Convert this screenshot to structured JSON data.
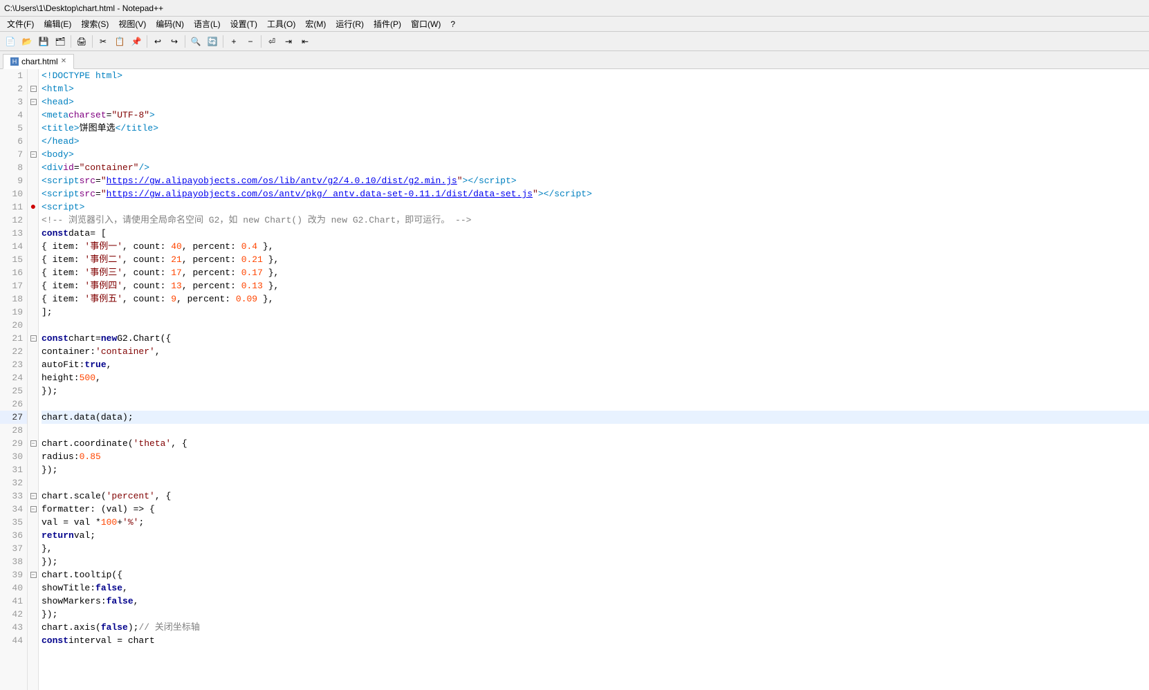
{
  "window": {
    "title": "C:\\Users\\1\\Desktop\\chart.html - Notepad++",
    "tab_label": "chart.html"
  },
  "menu": {
    "items": [
      "文件(F)",
      "编辑(E)",
      "搜索(S)",
      "视图(V)",
      "编码(N)",
      "语言(L)",
      "设置(T)",
      "工具(O)",
      "宏(M)",
      "运行(R)",
      "插件(P)",
      "窗口(W)",
      "?"
    ]
  },
  "code_lines": [
    {
      "num": 1,
      "fold": "",
      "content": "<!DOCTYPE html>"
    },
    {
      "num": 2,
      "fold": "□",
      "content": "    <html>"
    },
    {
      "num": 3,
      "fold": "□",
      "content": "        <head>"
    },
    {
      "num": 4,
      "fold": "",
      "content": "            <meta charset=\"UTF-8\">"
    },
    {
      "num": 5,
      "fold": "",
      "content": "            <title>饼图单选</title>"
    },
    {
      "num": 6,
      "fold": "",
      "content": "        </head>"
    },
    {
      "num": 7,
      "fold": "□",
      "content": "        <body>"
    },
    {
      "num": 8,
      "fold": "",
      "content": "            <div id=\"container\" />"
    },
    {
      "num": 9,
      "fold": "",
      "content": "            <script src=\"https://gw.alipayobjects.com/os/lib/antv/g2/4.0.10/dist/g2.min.js\"></script>"
    },
    {
      "num": 10,
      "fold": "",
      "content": "            <script src=\"https://gw.alipayobjects.com/os/antv/pkg/_antv.data-set-0.11.1/dist/data-set.js\"></script>"
    },
    {
      "num": 11,
      "fold": "□",
      "content": "            <script>"
    },
    {
      "num": 12,
      "fold": "",
      "content": "            <!-- 浏览器引入，请使用全局命名空间 G2，如 new Chart() 改为 new G2.Chart，即可运行。 -->"
    },
    {
      "num": 13,
      "fold": "",
      "content": "                const data = ["
    },
    {
      "num": 14,
      "fold": "",
      "content": "  { item: '事例一', count: 40, percent: 0.4 },"
    },
    {
      "num": 15,
      "fold": "",
      "content": "  { item: '事例二', count: 21, percent: 0.21 },"
    },
    {
      "num": 16,
      "fold": "",
      "content": "  { item: '事例三', count: 17, percent: 0.17 },"
    },
    {
      "num": 17,
      "fold": "",
      "content": "  { item: '事例四', count: 13, percent: 0.13 },"
    },
    {
      "num": 18,
      "fold": "",
      "content": "  { item: '事例五', count: 9, percent: 0.09 },"
    },
    {
      "num": 19,
      "fold": "",
      "content": "];"
    },
    {
      "num": 20,
      "fold": "",
      "content": ""
    },
    {
      "num": 21,
      "fold": "□",
      "content": "      const chart = new G2.Chart({"
    },
    {
      "num": 22,
      "fold": "",
      "content": "        container: 'container',"
    },
    {
      "num": 23,
      "fold": "",
      "content": "        autoFit: true,"
    },
    {
      "num": 24,
      "fold": "",
      "content": "        height: 500,"
    },
    {
      "num": 25,
      "fold": "",
      "content": "      });"
    },
    {
      "num": 26,
      "fold": "",
      "content": ""
    },
    {
      "num": 27,
      "fold": "",
      "content": "      chart.data(data);",
      "highlight": true
    },
    {
      "num": 28,
      "fold": "",
      "content": ""
    },
    {
      "num": 29,
      "fold": "□",
      "content": "      chart.coordinate('theta', {"
    },
    {
      "num": 30,
      "fold": "",
      "content": "        radius: 0.85"
    },
    {
      "num": 31,
      "fold": "",
      "content": "      });"
    },
    {
      "num": 32,
      "fold": "",
      "content": ""
    },
    {
      "num": 33,
      "fold": "□",
      "content": "      chart.scale('percent', {"
    },
    {
      "num": 34,
      "fold": "□",
      "content": "        formatter: (val) => {"
    },
    {
      "num": 35,
      "fold": "",
      "content": "          val = val * 100 + '%';"
    },
    {
      "num": 36,
      "fold": "",
      "content": "          return val;"
    },
    {
      "num": 37,
      "fold": "",
      "content": "        },"
    },
    {
      "num": 38,
      "fold": "",
      "content": "      });"
    },
    {
      "num": 39,
      "fold": "□",
      "content": "      chart.tooltip({"
    },
    {
      "num": 40,
      "fold": "",
      "content": "        showTitle: false,"
    },
    {
      "num": 41,
      "fold": "",
      "content": "        showMarkers: false,"
    },
    {
      "num": 42,
      "fold": "",
      "content": "      });"
    },
    {
      "num": 43,
      "fold": "",
      "content": "      chart.axis(false); // 关闭坐标轴"
    },
    {
      "num": 44,
      "fold": "",
      "content": "      const interval = chart"
    }
  ]
}
